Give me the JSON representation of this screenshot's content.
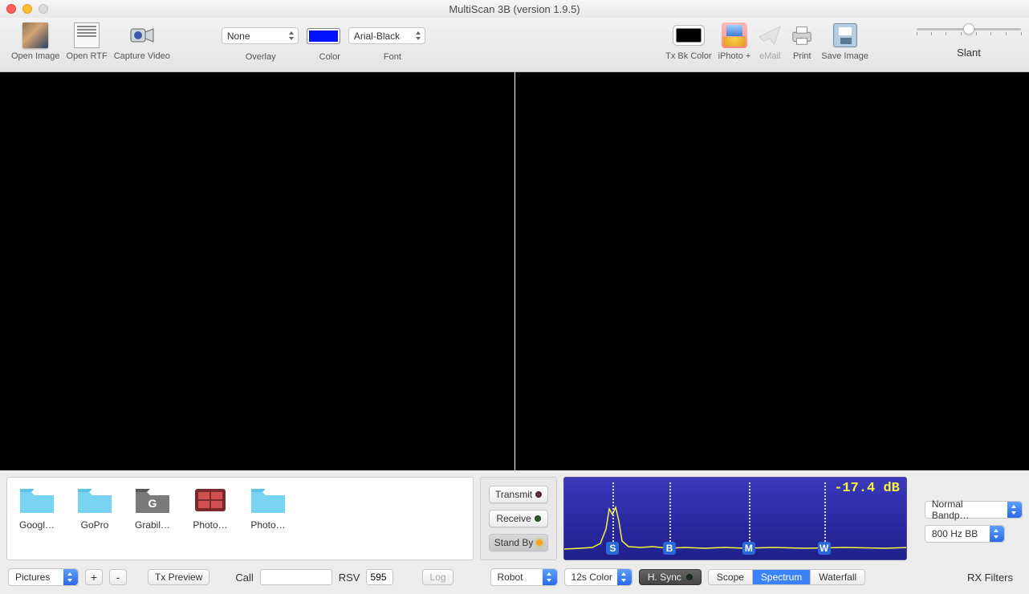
{
  "window": {
    "title": "MultiScan 3B (version 1.9.5)"
  },
  "toolbar": {
    "open_image": "Open Image",
    "open_rtf": "Open RTF",
    "capture_video": "Capture Video",
    "overlay": {
      "label": "Overlay",
      "value": "None"
    },
    "color": {
      "label": "Color",
      "hex": "#0011ff"
    },
    "font": {
      "label": "Font",
      "value": "Arial-Black"
    },
    "tx_bk_color": "Tx Bk Color",
    "iphoto": "iPhoto +",
    "email": "eMail",
    "print": "Print",
    "save_image": "Save Image",
    "slant": "Slant"
  },
  "folders": [
    {
      "label": "Googl…"
    },
    {
      "label": "GoPro"
    },
    {
      "label": "Grabil…"
    },
    {
      "label": "Photo…"
    },
    {
      "label": "Photo…"
    }
  ],
  "controls": {
    "transmit": "Transmit",
    "receive": "Receive",
    "standby": "Stand By"
  },
  "spectrum": {
    "db": "-17.4 dB",
    "markers": [
      "S",
      "B",
      "M",
      "W"
    ]
  },
  "filters": {
    "label": "RX Filters",
    "mode": "Normal Bandp…",
    "bw": "800 Hz BB"
  },
  "bottom": {
    "source": "Pictures",
    "plus": "+",
    "minus": "-",
    "tx_preview": "Tx Preview",
    "call": "Call",
    "call_value": "",
    "rsv": "RSV",
    "rsv_value": "595",
    "log": "Log",
    "mode_a": "Robot",
    "mode_b": "12s Color",
    "hsync": "H. Sync",
    "seg": {
      "scope": "Scope",
      "spectrum": "Spectrum",
      "waterfall": "Waterfall"
    }
  }
}
